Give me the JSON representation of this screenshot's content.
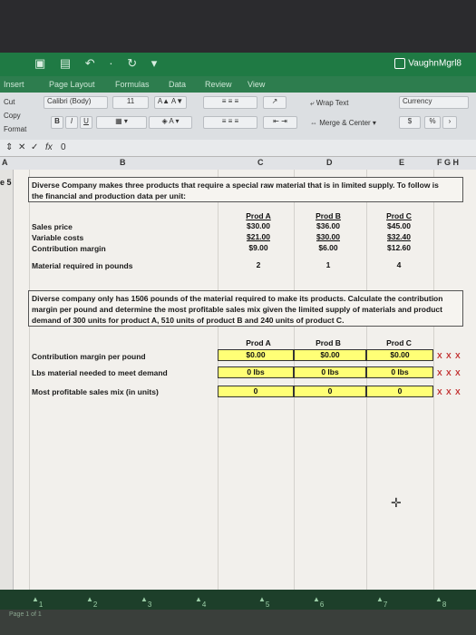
{
  "window": {
    "user": "VaughnMgrl8",
    "qat_icons": [
      "grid-icon",
      "save-icon",
      "undo-icon",
      "redo-icon",
      "customize-icon"
    ]
  },
  "ribbon_tabs": [
    "Insert",
    "Page Layout",
    "Formulas",
    "Data",
    "Review",
    "View"
  ],
  "ribbon": {
    "cut": "Cut",
    "copy": "Copy",
    "format": "Format",
    "font_name": "Calibri (Body)",
    "font_size": "11",
    "bold": "B",
    "italic": "I",
    "underline": "U",
    "wrap_text": "Wrap Text",
    "merge_center": "Merge & Center",
    "number_format": "Currency",
    "dollar": "$",
    "percent": "%"
  },
  "formula_bar": {
    "fx": "fx",
    "value": "0"
  },
  "columns": [
    "A",
    "B",
    "C",
    "D",
    "E",
    "F G H"
  ],
  "row_label": "e 5",
  "problem": {
    "intro_line1": "Diverse Company makes three products that require a special raw material that is in limited supply. To follow is",
    "intro_line2": "the financial and production data per unit:",
    "product_headers": [
      "Prod A",
      "Prod B",
      "Prod C"
    ],
    "rows": [
      {
        "label": "Sales price",
        "values": [
          "$30.00",
          "$36.00",
          "$45.00"
        ]
      },
      {
        "label": "Variable costs",
        "values": [
          "$21.00",
          "$30.00",
          "$32.40"
        ]
      },
      {
        "label": "Contribution margin",
        "values": [
          "$9.00",
          "$6.00",
          "$12.60"
        ]
      },
      {
        "label": "Material required in pounds",
        "values": [
          "2",
          "1",
          "4"
        ]
      }
    ],
    "question_line1": "Diverse company only has 1506 pounds of the material required to make its products. Calculate the contribution",
    "question_line2": "margin per pound and determine the most profitable sales mix given the limited supply of materials and product",
    "question_line3": "demand of 300 units for product A, 510 units of product B and 240 units of product C."
  },
  "answer": {
    "headers": [
      "Prod A",
      "Prod B",
      "Prod C"
    ],
    "rows": [
      {
        "label": "Contribution margin per pound",
        "values": [
          "$0.00",
          "$0.00",
          "$0.00"
        ],
        "flag": "X X X"
      },
      {
        "label": "Lbs material needed to meet demand",
        "values": [
          "0 lbs",
          "0 lbs",
          "0 lbs"
        ],
        "flag": "X X X"
      },
      {
        "label": "Most profitable sales mix (in units)",
        "values": [
          "0",
          "0",
          "0"
        ],
        "flag": "X X X"
      }
    ]
  },
  "sheet_tabs": [
    "1",
    "2",
    "3",
    "4",
    "5",
    "6",
    "7",
    "8"
  ],
  "status": "Page 1 of 1",
  "colors": {
    "ribbon_green": "#1f7a44",
    "highlight_yellow": "#ffff76",
    "error_red": "#c22f2f"
  }
}
